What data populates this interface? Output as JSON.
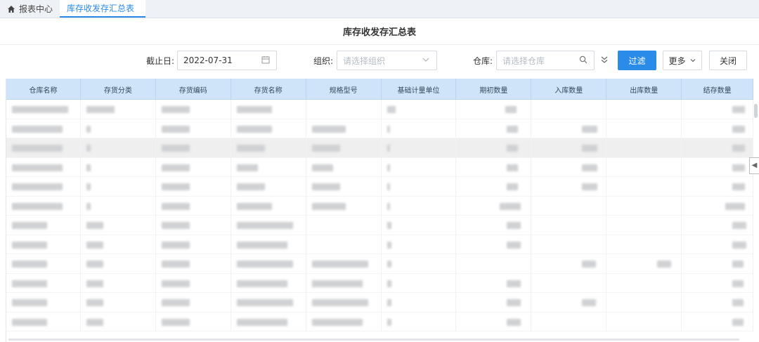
{
  "tabs": [
    {
      "label": "报表中心",
      "icon": "home-icon"
    },
    {
      "label": "库存收发存汇总表"
    }
  ],
  "title": "库存收发存汇总表",
  "filters": {
    "deadline_label": "截止日:",
    "deadline_value": "2022-07-31",
    "org_label": "组织:",
    "org_placeholder": "请选择组织",
    "warehouse_label": "仓库:",
    "warehouse_placeholder": "请选择仓库"
  },
  "buttons": {
    "filter": "过滤",
    "more": "更多",
    "close": "关闭"
  },
  "columns": [
    "仓库名称",
    "存货分类",
    "存货编码",
    "存货名称",
    "规格型号",
    "基础计量单位",
    "期初数量",
    "入库数量",
    "出库数量",
    "结存数量"
  ],
  "colors": {
    "accent": "#2a8be8",
    "header_bg": "#cfe4f8"
  }
}
